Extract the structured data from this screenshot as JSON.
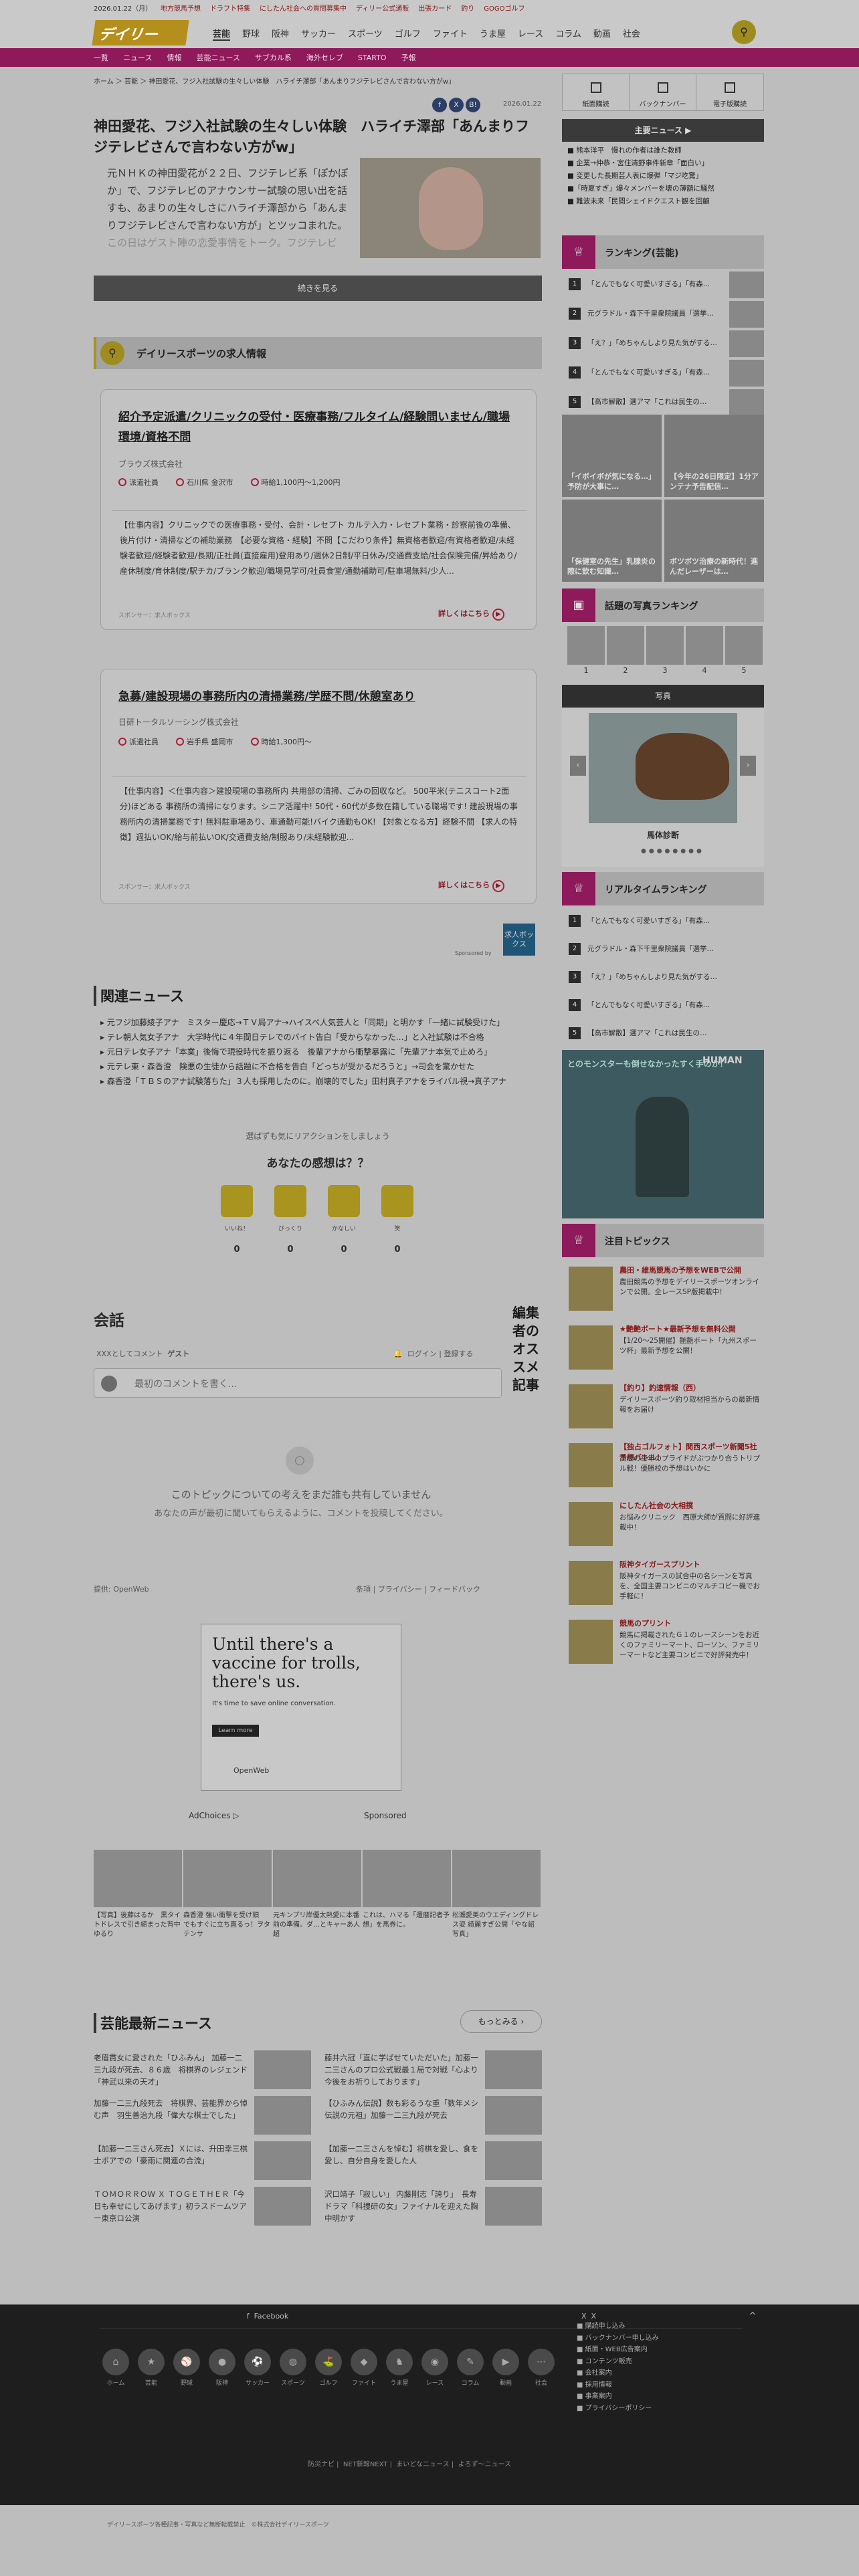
{
  "topbar": {
    "date": "2026.01.22（月）",
    "links": [
      "地方競馬予想",
      "ドラフト特集",
      "にしたん社会への質問募集中",
      "ディリー公式通販",
      "出張カード",
      "釣り",
      "GOGOゴルフ"
    ]
  },
  "header": {
    "logo": "デイリー",
    "nav": [
      "芸能",
      "野球",
      "阪神",
      "サッカー",
      "スポーツ",
      "ゴルフ",
      "ファイト",
      "うま屋",
      "レース",
      "コラム",
      "動画",
      "社会"
    ]
  },
  "subnav": [
    "一覧",
    "ニュース",
    "情報",
    "芸能ニュース",
    "サブカル系",
    "海外セレブ",
    "STARTO",
    "予報"
  ],
  "breadcrumb": "ホーム ＞ 芸能 ＞ 神田愛花、フジ入社試験の生々しい体験　ハライチ澤部「あんまりフジテレビさんで言わない方がw」",
  "article": {
    "title": "神田愛花、フジ入社試験の生々しい体験　ハライチ澤部「あんまりフジテレビさんで言わない方がw」",
    "date": "2026.01.22",
    "lead": "元ＮＨＫの神田愛花が２２日、フジテレビ系「ぽかぽか」で、フジテレビのアナウンサー試験の思い出を話すも、あまりの生々しさにハライチ澤部から「あんまりフジテレビさんで言わない方が」とツッコまれた。",
    "lead_fade": "この日はゲスト陣の恋愛事情をトーク。フジテレビ",
    "continue": "続きを見る"
  },
  "jobs": {
    "header": "デイリースポーツの求人情報",
    "cards": [
      {
        "title": "紹介予定派遣/クリニックの受付・医療事務/フルタイム/経験問いません/職場環境/資格不問",
        "company": "ブラウズ株式会社",
        "type": "派遣社員",
        "place": "石川県 金沢市",
        "pay": "時給1,100円〜1,200円",
        "desc": "【仕事内容】クリニックでの医療事務・受付、会計・レセプト カルテ入力・レセプト業務・診察前後の準備、後片付け・清掃などの補助業務　【必要な資格・経験】不問【こだわり条件】無資格者歓迎/有資格者歓迎/未経験者歓迎/経験者歓迎/長期/正社員(直接雇用)登用あり/週休2日制/平日休み/交通費支給/社会保険完備/昇給あり/産休制度/育休制度/駅チカ/ブランク歓迎/職場見学可/社員食堂/通勤補助可/駐車場無料/少人...",
        "sponsor": "スポンサー：求人ボックス",
        "more": "詳しくはこちら"
      },
      {
        "title": "急募/建設現場の事務所内の清掃業務/学歴不問/休憩室あり",
        "company": "日研トータルソーシング株式会社",
        "type": "派遣社員",
        "place": "岩手県 盛岡市",
        "pay": "時給1,300円〜",
        "desc": "【仕事内容】＜仕事内容＞建設現場の事務所内 共用部の清掃、ごみの回収など。 500平米(テニスコート2面分)ほどある 事務所の清掃になります。シニア活躍中! 50代・60代が多数在籍している職場です! 建設現場の事務所内の清掃業務です! 無料駐車場あり、車通勤可能!バイク通勤もOK! 【対象となる方】経験不問 【求人の特徴】週払いOK/給与前払いOK/交通費支給/制服あり/未経験歓迎...",
        "sponsor": "スポンサー：求人ボックス",
        "more": "詳しくはこちら"
      }
    ],
    "badge": "求人ボックス",
    "sponsored_by": "Sponsored by"
  },
  "related": {
    "title": "関連ニュース",
    "items": [
      "元フジ加藤綾子アナ　ミスター慶応→ＴＶ局アナ→ハイスペ人気芸人と「同期」と明かす「一緒に試験受けた」",
      "テレ朝人気女子アナ　大学時代に４年間日テレでのバイト告白「受からなかった…」と入社試験は不合格",
      "元日テレ女子アナ「本業」後悔で現役時代を振り返る　後輩アナから衝撃暴露に「先輩アナ本気で止めろ」",
      "元テレ東・森香澄　険悪の生徒から話題に不合格を告白「どっちが受かるだろうと」→司会を驚かせた",
      "森香澄「ＴＢＳのアナ試験落ちた」３人も採用したのに。崩壊的でした」田村真子アナをライバル視→真子アナ"
    ]
  },
  "reactions": {
    "prompt": "選ばずも気にリアクションをしましょう",
    "question": "あなたの感想は？？",
    "items": [
      {
        "label": "いいね！",
        "count": "0"
      },
      {
        "label": "びっくり",
        "count": "0"
      },
      {
        "label": "かなしい",
        "count": "0"
      },
      {
        "label": "笑",
        "count": "0"
      }
    ]
  },
  "comments": {
    "title": "会話",
    "sidebar_title": "編集者のオススメ記事",
    "xxx": "XXXとしてコメント",
    "guest": "ゲスト",
    "login": "ログイン",
    "signup": "登録する",
    "placeholder": "最初のコメントを書く...",
    "empty1": "このトピックについての考えをまだ誰も共有していません",
    "empty2": "あなたの声が最初に聞いてもらえるように、コメントを投稿してください。",
    "powered": "提供:",
    "openweb": "OpenWeb",
    "links": [
      "条項",
      "プライバシー",
      "フィードバック"
    ]
  },
  "ad": {
    "headline": "Until there's a vaccine for trolls, there's us.",
    "sub": "It's time to save online conversation.",
    "button": "Learn more",
    "brand": "OpenWeb",
    "adchoices": "AdChoices",
    "sponsored": "Sponsored"
  },
  "thumbs": [
    {
      "caption": "【写真】後藤はるか　黒タイトドレスで引き締まった背中ゆるり"
    },
    {
      "caption": "森香澄 強い衝撃を受け頭　でもすぐに立ち直るっ！ヲタテンサ"
    },
    {
      "caption": "元キンプリ岸優太熱愛に本番前の準備。ダ…とキャーあ人 超"
    },
    {
      "caption": "これは、ハマる「還暦記者予想」を馬券に。"
    },
    {
      "caption": "松瀬愛美のウエディングドレス姿 綺麗すぎ公開「やな紹写真」"
    }
  ],
  "geino": {
    "title": "芸能最新ニュース",
    "more": "もっとみる",
    "items": [
      "老眉貫女に愛された「ひふみん」 加藤一二三九段が死去、８６歳　将棋界のレジェンド「神武以来の天才」",
      "藤井六冠「直に学ばせていただいた」加藤一二三さんのプロ公式戦最１局で対戦「心より今後をお祈りしております」",
      "加藤一二三九段死去　将棋界、芸能界から悼む声　羽生善治九段「偉大な棋士でした」",
      "【ひふみん伝説】数も彩るうな重「数年メシ伝説の元祖」加藤一二三九段が死去",
      "【加藤一二三さん死去】Ｘには、升田幸三棋士ポアでの「豪雨に関連の合流」",
      "【加藤一二三さんを悼む】将棋を愛し、食を愛し、自分自身を愛した人",
      "ＴＯＭＯＲＲＯＷ Ｘ ＴＯＧＥＴＨＥＲ「今日も幸せにしてあげます」初ラスドームツアー東京ロ公演",
      "沢口靖子「寂しい」 内藤剛志「誇り」　長寿ドラマ「科捜研の女」ファイナルを迎えた胸中明かす"
    ]
  },
  "rail": {
    "tabs": [
      "紙面購読",
      "バックナンバー",
      "電子版購読"
    ],
    "main_news": "主要ニュース",
    "main_list": [
      "■ 熊本洋平　慢れの作者は誰た教師",
      "■ 企業→仲恭・宮住清野事件新章「面白い」",
      "■ 変更した長期芸人表に爆弾「マジ吃驚」",
      "■「時夏すぎ」爆々メンバーを壊の薄額に騒然",
      "■ 難波未来「民間シェイドクエスト観を回顧"
    ],
    "ranking_title": "ランキング(芸能)",
    "ranking": [
      "「とんでもなく可愛いすぎる」「有森…",
      "元グラドル・森下千里衆院議員「選挙…",
      "「え？」「めちゃんしより見た気がする…",
      "「とんでもなく可愛いすぎる」「有森…",
      "【高市解散】選アマ「これは民生の…"
    ],
    "tiles": [
      "「イボイボが気になる…」予防が大事に…",
      "【今年の26日限定】1分アンテナ予告配信…",
      "「保健室の先生」乳腺炎の際に飲む知識…",
      "ボツボツ治療の新時代！進んだレーザーは…"
    ],
    "photo_rank_title": "話題の写真ランキング",
    "photo_ranks": [
      "1",
      "2",
      "3",
      "4",
      "5"
    ],
    "photo_title": "写真",
    "photo_caption": "馬体診断",
    "realtime_title": "リアルタイムランキング",
    "realtime": [
      "「とんでもなく可愛いすぎる」「有森…",
      "元グラドル・森下千里衆院議員「選挙…",
      "「え？」「めちゃんしより見た気がする…",
      "「とんでもなく可愛いすぎる」「有森…",
      "【高市解散】選アマ「これは民生の…"
    ],
    "game_ad": "とのモンスターも倒せなかったすく手のか！",
    "game_brand": "HUMAN",
    "topics_title": "注目トピックス",
    "topics": [
      {
        "title": "農田・維馬競馬の予想をWEBで公開",
        "text": "農田競馬の予想をデイリースポーツオンラインで公開。全レースSP版掲載中！"
      },
      {
        "title": "★艶艶ボート★最新予想を無料公開",
        "text": "【1/20〜25開催】艶艶ボート「九州スポーツ杯」最新予想を公開！"
      },
      {
        "title": "【釣り】釣速情報（西）",
        "text": "デイリースポーツ釣り取材担当からの最新情報をお届け"
      },
      {
        "title": "【独占ゴルフォト】関西スポーツ新聞5社予想バトル！",
        "text": "高校の毎年のプライドがぶつかり合うトリプル戦！優勝校の予想はいかに"
      },
      {
        "title": "にしたん社会の大相撲",
        "text": "お悩みクリニック　西原大師が質問に好評連載中！"
      },
      {
        "title": "阪神タイガースプリント",
        "text": "阪神タイガースの試合中の名シーンを写真を、全国主要コンビニのマルチコピー機でお手軽に！"
      },
      {
        "title": "競馬のプリント",
        "text": "競馬に掲載されたＧ１のレースシーンをお近くのファミリーマート、ローソン、ファミリーマートなど主要コンビニで好評発売中！"
      }
    ]
  },
  "footer": {
    "facebook": "Facebook",
    "x": "X",
    "top": "^",
    "icons": [
      "ホーム",
      "芸能",
      "野球",
      "阪神",
      "サッカー",
      "スポーツ",
      "ゴルフ",
      "ファイト",
      "うま屋",
      "レース",
      "コラム",
      "動画",
      "社会"
    ],
    "links": [
      "■ 購読申し込み",
      "■ バックナンバー申し込み",
      "■ 紙面・WEB広告案内",
      "■ コンテンツ販売",
      "■ 会社案内",
      "■ 採用情報",
      "■ 事業案内",
      "■ プライバシーポリシー"
    ],
    "bottom": [
      "防災ナビ",
      "NET新報NEXT",
      "まいどなニュース",
      "よろず〜ニュース"
    ],
    "copyright": "デイリースポーツ各種記事・写真など無断転載禁止　©株式会社デイリースポーツ"
  }
}
